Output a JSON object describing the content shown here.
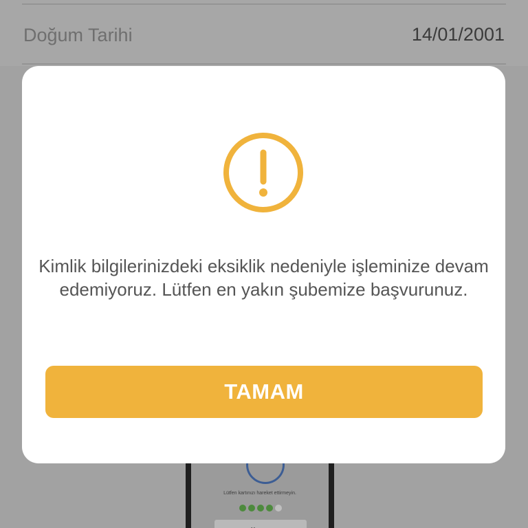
{
  "background": {
    "row_label": "Doğum Tarihi",
    "row_value": "14/01/2001",
    "illustration": {
      "instruction_text": "Lütfen kartınızı hareket ettirmeyin.",
      "progress_filled": 4,
      "progress_total": 5,
      "button_label": "Vazgeç"
    }
  },
  "dialog": {
    "icon": "warning-exclamation-icon",
    "message": "Kimlik bilgilerinizdeki eksiklik nedeniyle işleminize devam edemiyoruz. Lütfen en yakın şubemize başvurunuz.",
    "button_label": "TAMAM"
  },
  "colors": {
    "accent": "#f0b33c",
    "overlay": "#a2a2a2",
    "dialog_background": "#ffffff",
    "message_text": "#555555"
  }
}
